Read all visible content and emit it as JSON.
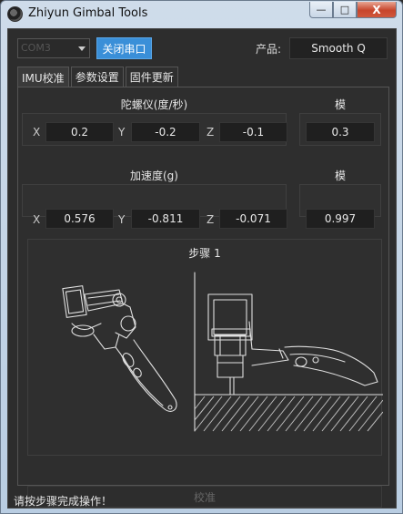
{
  "window": {
    "title": "Zhiyun Gimbal Tools",
    "minimize": "—",
    "maximize": "□",
    "close": "X"
  },
  "toolbar": {
    "port_value": "COM3",
    "close_port_label": "关闭串口",
    "product_label": "产品:",
    "product_value": "Smooth Q"
  },
  "tabs": [
    {
      "label": "IMU校准",
      "active": true
    },
    {
      "label": "参数设置",
      "active": false
    },
    {
      "label": "固件更新",
      "active": false
    }
  ],
  "gyro": {
    "title": "陀螺仪(度/秒)",
    "x_label": "X",
    "x_value": "0.2",
    "y_label": "Y",
    "y_value": "-0.2",
    "z_label": "Z",
    "z_value": "-0.1",
    "mod_title": "模",
    "mod_value": "0.3"
  },
  "accel": {
    "title": "加速度(g)",
    "x_label": "X",
    "x_value": "0.576",
    "y_label": "Y",
    "y_value": "-0.811",
    "z_label": "Z",
    "z_value": "-0.071",
    "mod_title": "模",
    "mod_value": "0.997"
  },
  "step": {
    "title": "步骤 1"
  },
  "calibrate_label": "校准",
  "status": "请按步骤完成操作！",
  "colors": {
    "accent": "#3a8fd8",
    "background": "#2d2d2d",
    "field": "#1f1f1f"
  }
}
